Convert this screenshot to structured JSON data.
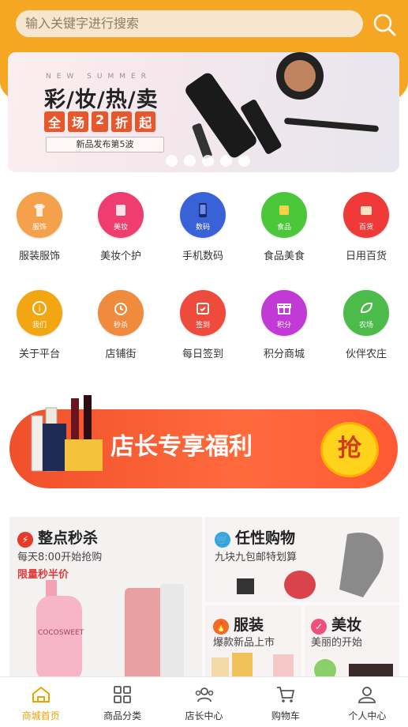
{
  "header": {
    "search_placeholder": "输入关键字进行搜索",
    "accent": "#f5a623"
  },
  "banner": {
    "subtitle": "NEW SUMMER",
    "title": "彩/妆/热/卖",
    "promo": [
      "全",
      "场",
      "2",
      "折",
      "起"
    ],
    "release": "新品发布第5波",
    "dots": 5
  },
  "categories": [
    {
      "label": "服装服饰",
      "tag": "服饰",
      "color": "#f5a04a",
      "icon": "clothes-icon"
    },
    {
      "label": "美妆个护",
      "tag": "美妆",
      "color": "#ef3d6f",
      "icon": "makeup-icon"
    },
    {
      "label": "手机数码",
      "tag": "数码",
      "color": "#3a62d8",
      "icon": "phone-icon"
    },
    {
      "label": "食品美食",
      "tag": "食品",
      "color": "#4bc73a",
      "icon": "food-icon"
    },
    {
      "label": "日用百货",
      "tag": "百货",
      "color": "#ef3a3a",
      "icon": "goods-icon"
    }
  ],
  "services": [
    {
      "label": "关于平台",
      "tag": "我们",
      "color": "#f2a712",
      "icon": "info-icon"
    },
    {
      "label": "店铺街",
      "tag": "秒杀",
      "color": "#f08a3c",
      "icon": "clock-icon"
    },
    {
      "label": "每日签到",
      "tag": "签到",
      "color": "#ee4b3d",
      "icon": "calendar-icon"
    },
    {
      "label": "积分商城",
      "tag": "积分",
      "color": "#c23ad6",
      "icon": "gift-icon"
    },
    {
      "label": "伙伴农庄",
      "tag": "农场",
      "color": "#4cbb4a",
      "icon": "leaf-icon"
    }
  ],
  "promo_banner": {
    "text": "店长专享福利",
    "grab": "抢"
  },
  "flash_sale": {
    "title": "整点秒杀",
    "desc": "每天8:00开始抢购",
    "tag": "限量秒半价",
    "brand": "COCOSWEET"
  },
  "any_buy": {
    "title": "任性购物",
    "desc": "九块九包邮特划算"
  },
  "clothing": {
    "title": "服装",
    "desc": "爆款新品上市"
  },
  "beauty": {
    "title": "美妆",
    "desc": "美丽的开始"
  },
  "nav": [
    {
      "label": "商城首页",
      "icon": "home-icon",
      "active": true
    },
    {
      "label": "商品分类",
      "icon": "category-icon",
      "active": false
    },
    {
      "label": "店长中心",
      "icon": "team-icon",
      "active": false
    },
    {
      "label": "购物车",
      "icon": "cart-icon",
      "active": false
    },
    {
      "label": "个人中心",
      "icon": "user-icon",
      "active": false
    }
  ]
}
